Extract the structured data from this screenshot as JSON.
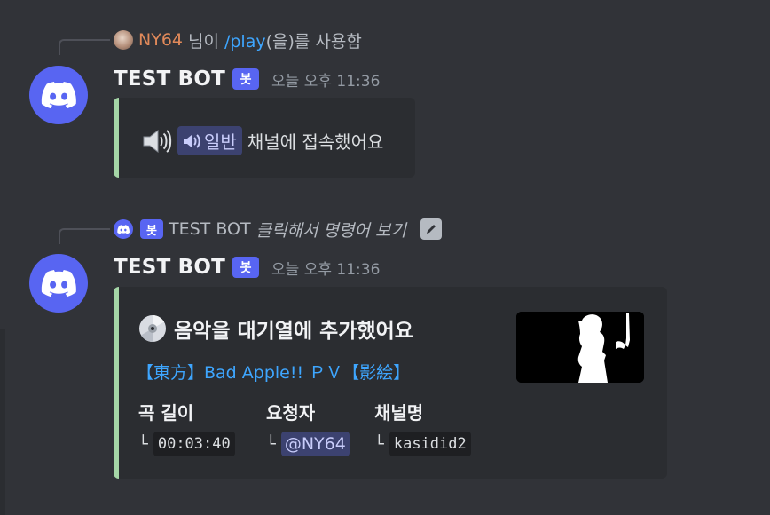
{
  "message1": {
    "reply": {
      "user": "NY64",
      "text_before": "님이",
      "command": "/play",
      "text_after": "(을)를 사용함"
    },
    "author": "TEST BOT",
    "bot_tag": "봇",
    "timestamp": "오늘 오후 11:36",
    "embed": {
      "accent_color": "#a5d6a7",
      "speaker_icon": "speaker-icon",
      "channel_mention": "일반",
      "text": "채널에 접속했어요"
    }
  },
  "message2": {
    "reply": {
      "bot_tag": "봇",
      "author": "TEST BOT",
      "italic_text": "클릭해서 명령어 보기"
    },
    "author": "TEST BOT",
    "bot_tag": "봇",
    "timestamp": "오늘 오후 11:36",
    "embed": {
      "accent_color": "#a5d6a7",
      "title_icon": "cd-icon",
      "title": "음악을 대기열에 추가했어요",
      "description": "【東方】Bad Apple!! ＰＶ【影絵】",
      "fields": [
        {
          "name": "곡 길이",
          "corner": "└",
          "value": "00:03:40"
        },
        {
          "name": "요청자",
          "corner": "└",
          "value": "@NY64"
        },
        {
          "name": "채널명",
          "corner": "└",
          "value": "kasidid2"
        }
      ]
    }
  },
  "colors": {
    "background": "#313338",
    "embed_background": "#2b2d31",
    "blurple": "#5865f2",
    "link": "#3ea6ff",
    "user_name": "#e0895a"
  }
}
